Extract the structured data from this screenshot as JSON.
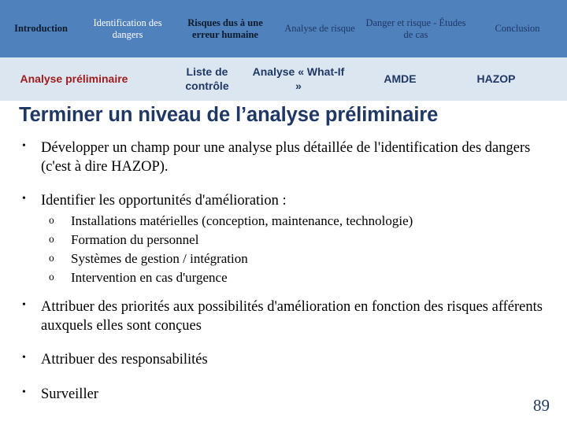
{
  "nav_top": {
    "items": [
      {
        "label": "Introduction",
        "style": "dark"
      },
      {
        "label": "Identification des dangers",
        "style": "white"
      },
      {
        "label": "Risques dus à une erreur humaine",
        "style": "dark"
      },
      {
        "label": "Analyse de risque",
        "style": "navy"
      },
      {
        "label": "Danger et risque - Études de cas",
        "style": "navy"
      },
      {
        "label": "Conclusion",
        "style": "navy"
      }
    ],
    "background_color": "#4f81bd"
  },
  "nav_sub": {
    "items": [
      {
        "label": "Analyse préliminaire",
        "active": true
      },
      {
        "label": "Liste de contrôle",
        "active": false
      },
      {
        "label": "Analyse « What-If »",
        "active": false
      },
      {
        "label": "AMDE",
        "active": false
      },
      {
        "label": "HAZOP",
        "active": false
      }
    ],
    "background_color": "#dce6f1",
    "active_color": "#9e1b1b",
    "inactive_color": "#1f3864"
  },
  "slide": {
    "title": "Terminer un niveau de l’analyse préliminaire",
    "title_color": "#1f3864",
    "bullets": {
      "b1": "Développer un  champ pour une analyse plus détaillée de l'identification des dangers (c'est à dire HAZOP).",
      "b2": "Identifier les opportunités d'amélioration :",
      "b2_sub": [
        " Installations matérielles (conception, maintenance, technologie)",
        "Formation du personnel",
        "Systèmes de gestion / intégration",
        "Intervention en cas d'urgence"
      ],
      "b3": "Attribuer des priorités aux possibilités d'amélioration en fonction des risques afférents auxquels  elles sont conçues",
      "b4": "Attribuer des responsabilités",
      "b5": "Surveiller"
    },
    "page_number": "89"
  }
}
